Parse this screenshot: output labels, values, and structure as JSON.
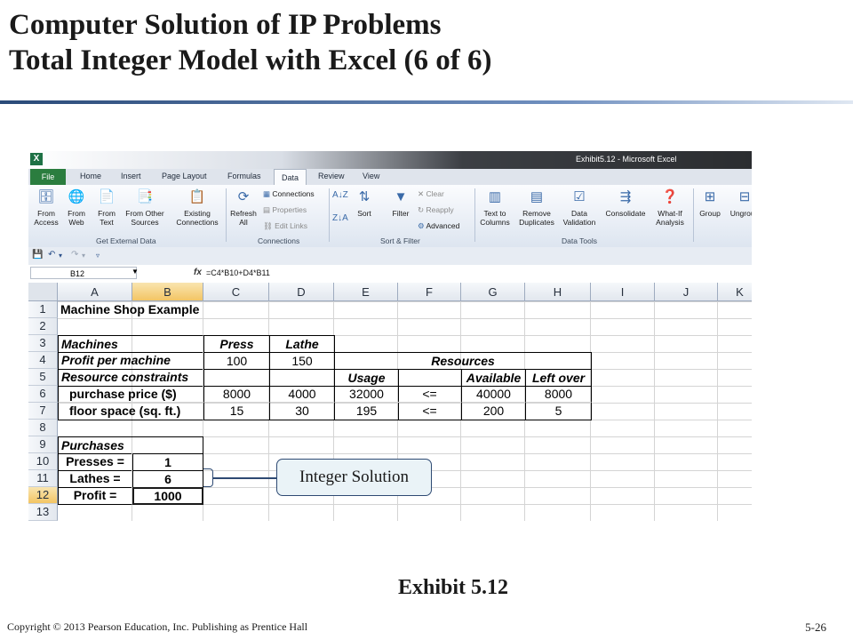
{
  "slide": {
    "title_line1": "Computer Solution of IP Problems",
    "title_line2": "Total Integer Model with Excel (6 of 6)",
    "callout": "Integer Solution",
    "caption": "Exhibit 5.12",
    "copyright": "Copyright © 2013 Pearson Education, Inc. Publishing as Prentice Hall",
    "page_number": "5-26"
  },
  "excel": {
    "window_title": "Exhibit5.12 - Microsoft Excel",
    "app_icon_label": "X",
    "tabs": [
      "File",
      "Home",
      "Insert",
      "Page Layout",
      "Formulas",
      "Data",
      "Review",
      "View"
    ],
    "active_tab": "Data",
    "ribbon": {
      "get_external_data": {
        "label": "Get External Data",
        "from_access": "From Access",
        "from_web": "From Web",
        "from_text": "From Text",
        "from_other_sources": "From Other Sources",
        "existing_connections": "Existing Connections"
      },
      "connections": {
        "label": "Connections",
        "refresh_all": "Refresh All",
        "connections": "Connections",
        "properties": "Properties",
        "edit_links": "Edit Links"
      },
      "sort_filter": {
        "label": "Sort & Filter",
        "sort": "Sort",
        "filter": "Filter",
        "clear": "Clear",
        "reapply": "Reapply",
        "advanced": "Advanced"
      },
      "data_tools": {
        "label": "Data Tools",
        "text_to_columns": "Text to Columns",
        "remove_duplicates": "Remove Duplicates",
        "data_validation": "Data Validation",
        "consolidate": "Consolidate",
        "what_if_analysis": "What-If Analysis"
      },
      "outline": {
        "group": "Group",
        "ungroup": "Ungroup"
      }
    },
    "name_box": "B12",
    "formula": "=C4*B10+D4*B11",
    "columns": [
      "A",
      "B",
      "C",
      "D",
      "E",
      "F",
      "G",
      "H",
      "I",
      "J",
      "K"
    ],
    "rows": [
      "1",
      "2",
      "3",
      "4",
      "5",
      "6",
      "7",
      "8",
      "9",
      "10",
      "11",
      "12",
      "13"
    ],
    "cells": {
      "a1": "Machine Shop Example",
      "a3": "Machines",
      "c3": "Press",
      "d3": "Lathe",
      "a4": "Profit per machine",
      "c4": "100",
      "d4": "150",
      "e4": "Resources",
      "a5": "Resource constraints",
      "e5": "Usage",
      "g5": "Available",
      "h5": "Left over",
      "a6": "purchase price ($)",
      "c6": "8000",
      "d6": "4000",
      "e6": "32000",
      "f6": "<=",
      "g6": "40000",
      "h6": "8000",
      "a7": "floor space (sq. ft.)",
      "c7": "15",
      "d7": "30",
      "e7": "195",
      "f7": "<=",
      "g7": "200",
      "h7": "5",
      "a9": "Purchases",
      "a10": "Presses =",
      "b10": "1",
      "a11": "Lathes =",
      "b11": "6",
      "a12": "Profit =",
      "b12": "1000"
    }
  }
}
